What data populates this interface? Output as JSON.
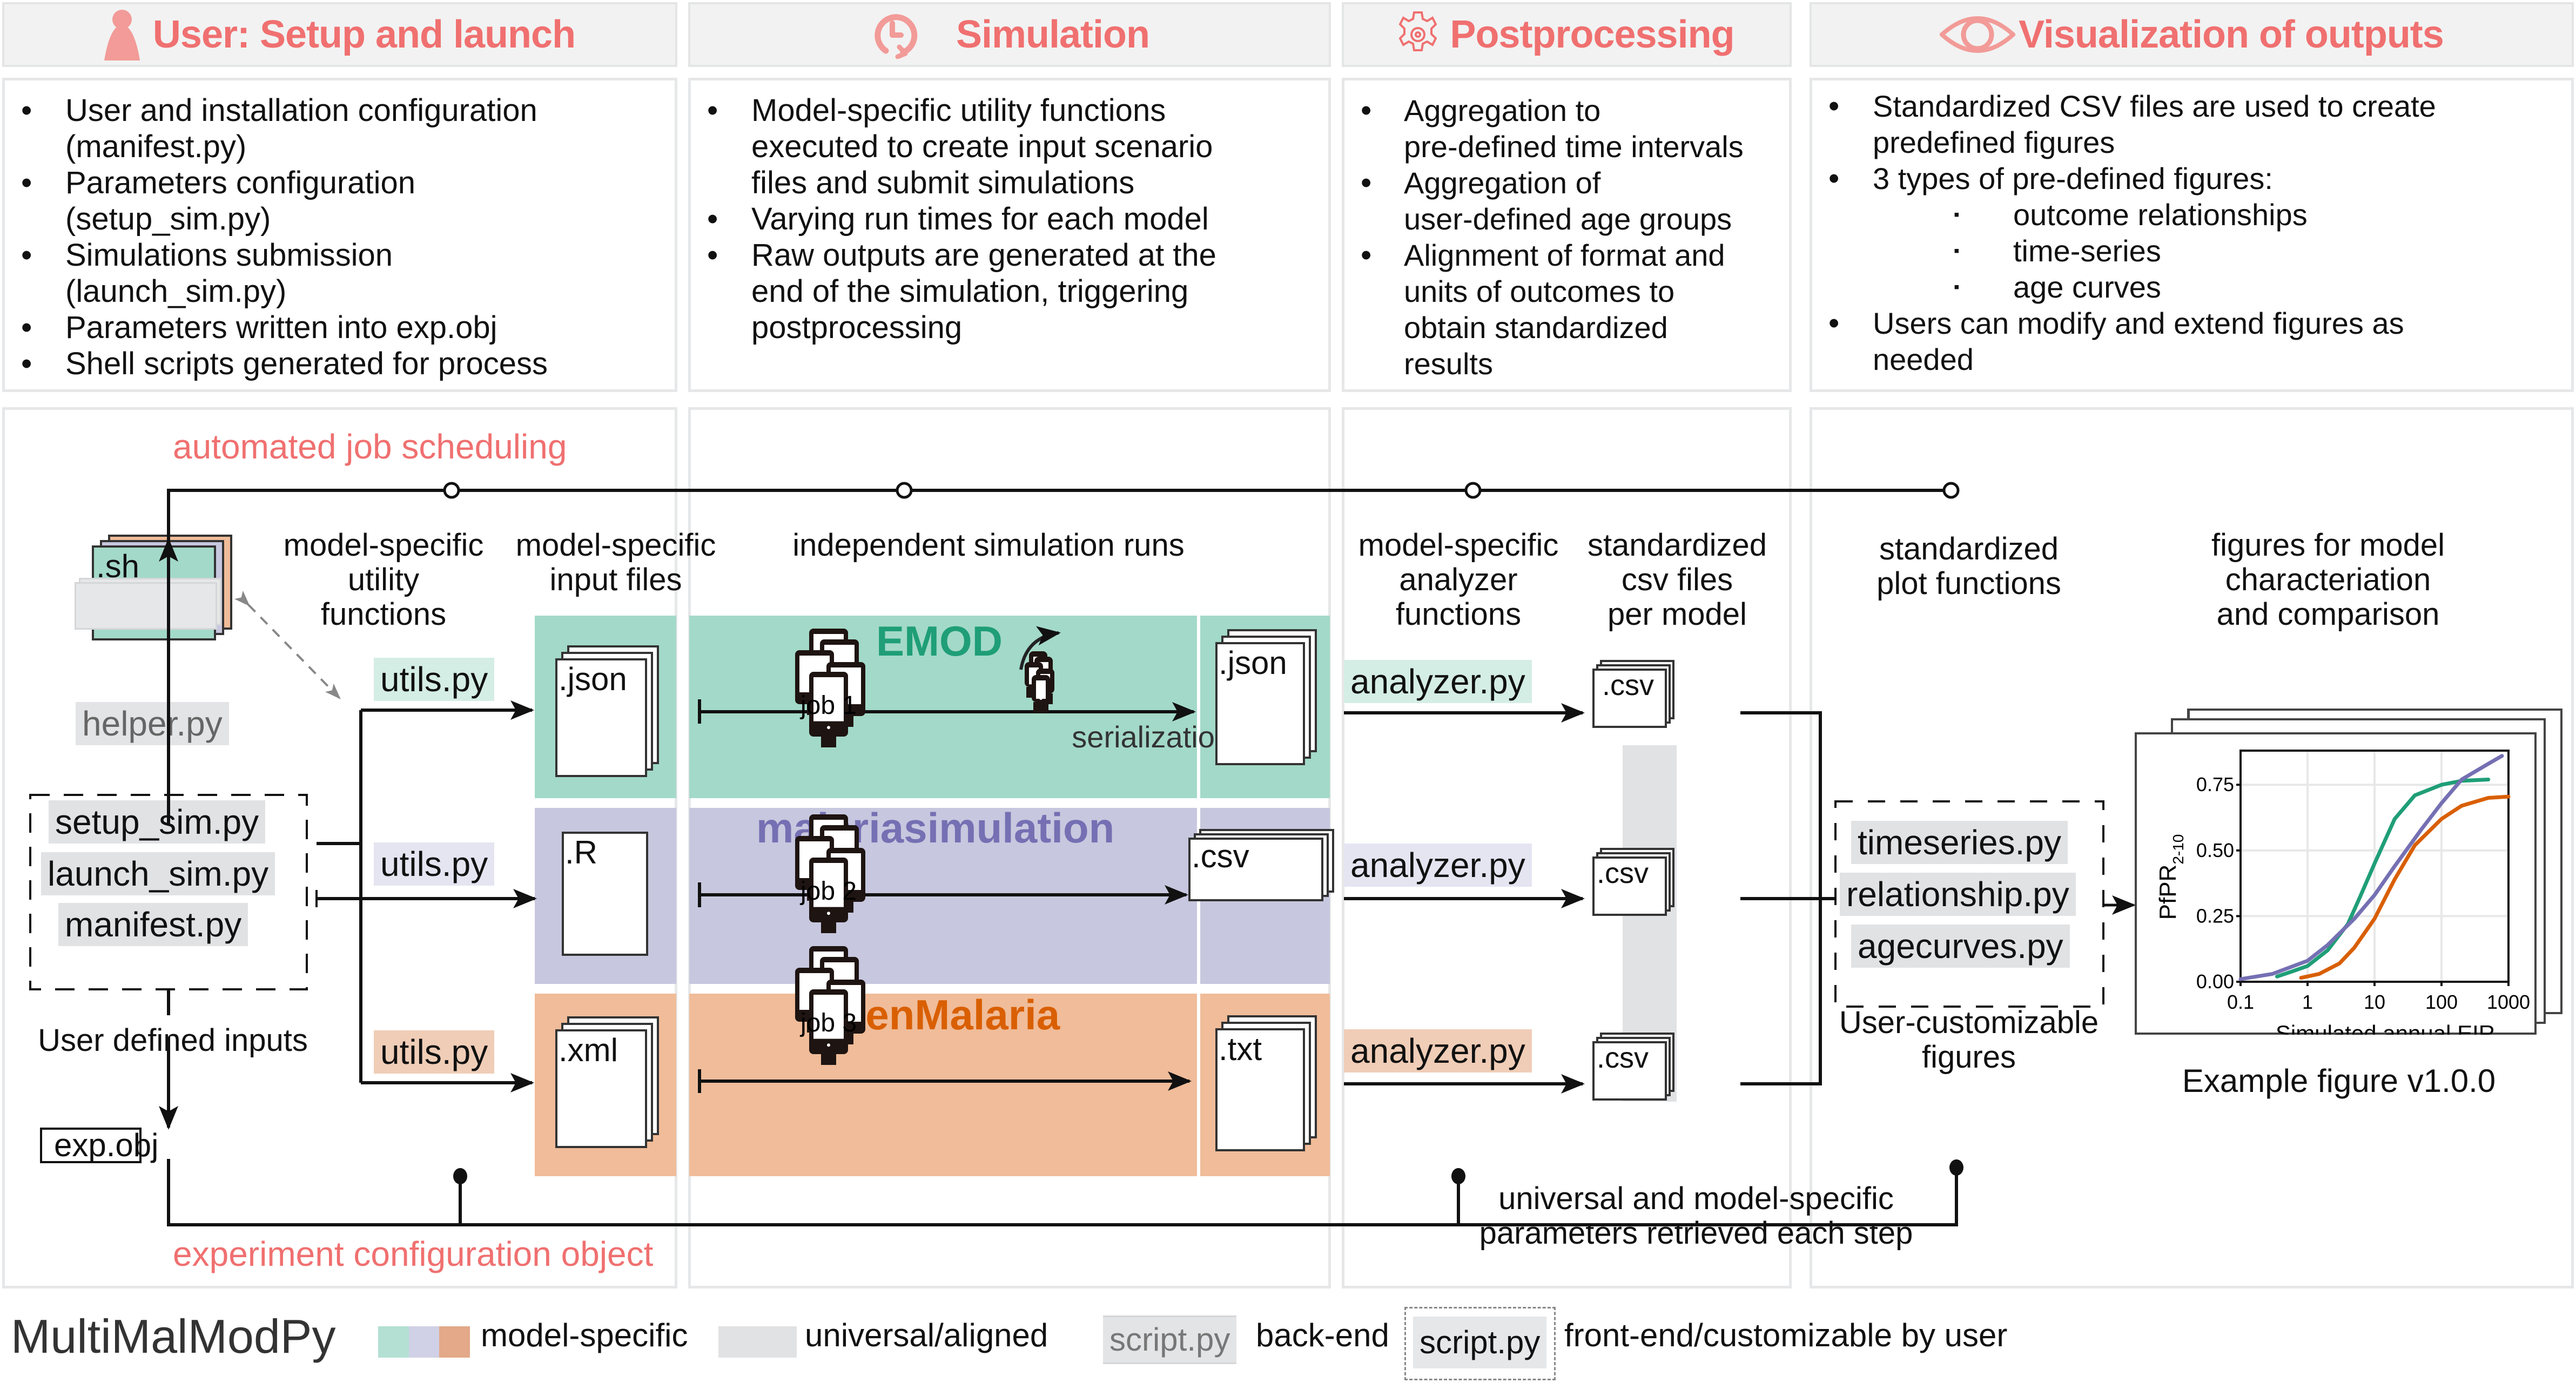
{
  "headers": [
    {
      "title": "User: Setup and launch",
      "icon": "person-icon"
    },
    {
      "title": "Simulation",
      "icon": "clock-refresh-icon"
    },
    {
      "title": "Postprocessing",
      "icon": "gear-icon"
    },
    {
      "title": "Visualization of outputs",
      "icon": "eye-icon"
    }
  ],
  "descriptions": {
    "setup": [
      "User and installation configuration",
      "(manifest.py)",
      "Parameters configuration",
      "(setup_sim.py)",
      "Simulations submission",
      "(launch_sim.py)",
      "Parameters written into exp.obj",
      "Shell scripts generated for process"
    ],
    "simulation": [
      "Model-specific utility functions",
      "executed to create input scenario",
      "files and submit simulations",
      "Varying run times for each model",
      "Raw outputs are generated at the",
      "end of the simulation, triggering",
      "postprocessing"
    ],
    "postprocessing": [
      "Aggregation to",
      "pre-defined time intervals",
      "Aggregation of",
      "user-defined age groups",
      "Alignment of format and",
      "units of outcomes to",
      "obtain standardized",
      "results"
    ],
    "visualization": [
      "Standardized CSV files are used to create",
      "predefined figures",
      "3 types of pre-defined figures:",
      "outcome relationships",
      "time-series",
      "age curves",
      "Users can modify and extend figures as",
      "needed"
    ]
  },
  "flow": {
    "automated_label": "automated job scheduling",
    "experiment_label": "experiment configuration object",
    "sh_file": ".sh",
    "helper": "helper.py",
    "user_scripts": [
      "setup_sim.py",
      "launch_sim.py",
      "manifest.py"
    ],
    "user_inputs_label": "User defined inputs",
    "exp_obj": "exp.obj",
    "col_utility": [
      "model-specific",
      "utility",
      "functions"
    ],
    "col_input": [
      "model-specific",
      "input files"
    ],
    "col_runs": "independent simulation runs",
    "col_analyzer": [
      "model-specific",
      "analyzer",
      "functions"
    ],
    "col_csv": [
      "standardized",
      "csv files",
      "per model"
    ],
    "col_plot": [
      "standardized",
      "plot functions"
    ],
    "col_figures": [
      "figures for model",
      "characteriation",
      "and comparison"
    ],
    "utils": "utils.py",
    "analyzer": "analyzer.py",
    "serialization": "serialization",
    "models": [
      {
        "name": "EMOD",
        "input_ext": ".json",
        "output_ext": ".json",
        "job": "job 1",
        "color": "#1f9e77",
        "band": "#a3d9c8",
        "chip": "#d4ede5"
      },
      {
        "name": "malariasimulation",
        "input_ext": ".R",
        "output_ext": ".csv",
        "job": "job 2",
        "color": "#7570b3",
        "band": "#c7c7df",
        "chip": "#e5e4f1"
      },
      {
        "name": "OpenMalaria",
        "input_ext": ".xml",
        "output_ext": ".txt",
        "job": "job 3",
        "color": "#d95f02",
        "band": "#f0bc99",
        "chip": "#f0cdb7"
      }
    ],
    "csv_ext": ".csv",
    "plot_scripts": [
      "timeseries.py",
      "relationship.py",
      "agecurves.py"
    ],
    "user_custom_label": [
      "User-customizable",
      "figures"
    ],
    "example_caption": "Example figure v1.0.0",
    "params_label": [
      "universal and model-specific",
      "parameters retrieved each step"
    ]
  },
  "legend": {
    "app_name": "MultiMalModPy",
    "model_specific": "model-specific",
    "universal": "universal/aligned",
    "script_sample": "script.py",
    "backend": "back-end",
    "frontend": "front-end/customizable by user",
    "swatches": [
      "#b3e0d2",
      "#d0d0e6",
      "#e3a988"
    ],
    "universal_swatch": "#e1e2e4"
  },
  "chart_data": {
    "type": "line",
    "title": "",
    "xlabel": "Simulated annual EIR",
    "ylabel": "PfPR2-10",
    "ylabel_main": "PfPR",
    "ylabel_sub": "2-10",
    "xscale": "log",
    "xlim": [
      0.1,
      1000
    ],
    "ylim": [
      0,
      0.88
    ],
    "xticks": [
      0.1,
      1,
      10,
      100,
      1000
    ],
    "xtick_labels": [
      "0.1",
      "1",
      "10",
      "100",
      "1000"
    ],
    "yticks": [
      0.0,
      0.25,
      0.5,
      0.75
    ],
    "ytick_labels": [
      "0.00",
      "0.25",
      "0.50",
      "0.75"
    ],
    "grid": true,
    "series": [
      {
        "name": "EMOD",
        "color": "#1f9e77",
        "x": [
          0.35,
          0.6,
          1,
          2,
          4,
          6,
          10,
          20,
          40,
          100,
          200,
          500
        ],
        "y": [
          0.02,
          0.04,
          0.06,
          0.12,
          0.22,
          0.32,
          0.45,
          0.62,
          0.71,
          0.75,
          0.765,
          0.77
        ]
      },
      {
        "name": "malariasimulation",
        "color": "#7570b3",
        "x": [
          0.1,
          0.3,
          1,
          2,
          5,
          10,
          20,
          50,
          100,
          200,
          500,
          800
        ],
        "y": [
          0.01,
          0.03,
          0.08,
          0.14,
          0.24,
          0.33,
          0.44,
          0.58,
          0.68,
          0.77,
          0.83,
          0.86
        ]
      },
      {
        "name": "OpenMalaria",
        "color": "#d95f02",
        "x": [
          0.8,
          1.5,
          3,
          5,
          10,
          20,
          40,
          100,
          200,
          500,
          1000
        ],
        "y": [
          0.015,
          0.03,
          0.07,
          0.13,
          0.24,
          0.39,
          0.52,
          0.62,
          0.67,
          0.7,
          0.705
        ]
      }
    ]
  }
}
